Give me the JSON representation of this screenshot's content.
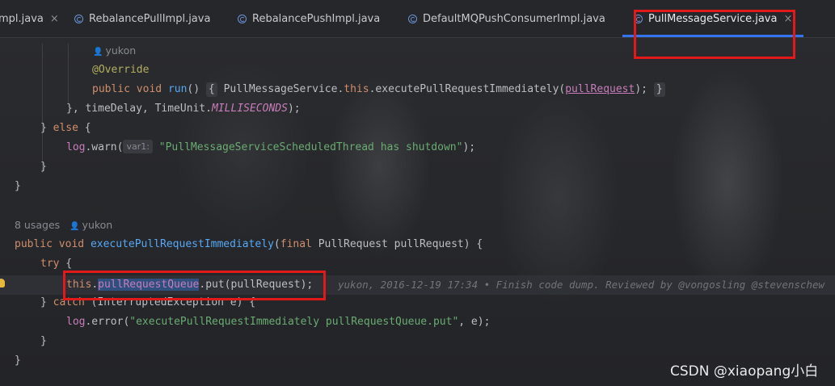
{
  "tabs": [
    {
      "label": "mpl.java",
      "close": "×",
      "icon": "class-icon"
    },
    {
      "label": "RebalancePullImpl.java",
      "icon": "class-icon"
    },
    {
      "label": "RebalancePushImpl.java",
      "icon": "class-icon"
    },
    {
      "label": "DefaultMQPushConsumerImpl.java",
      "icon": "class-icon"
    },
    {
      "label": "PullMessageService.java",
      "close": "×",
      "icon": "class-icon",
      "active": true
    }
  ],
  "code": {
    "author1": "yukon",
    "override": "@Override",
    "run_kw1": "public",
    "run_kw2": "void",
    "run_fn": "run",
    "run_parens": "()",
    "fold_open": "{",
    "run_body_1": "PullMessageService.",
    "run_body_this": "this",
    "run_body_2": ".executePullRequestImmediately(",
    "run_body_arg": "pullRequest",
    "run_body_3": ");",
    "fold_close": "}",
    "line_delay_1": "}, timeDelay, TimeUnit.",
    "line_delay_const": "MILLISECONDS",
    "line_delay_2": ");",
    "else_1": "} ",
    "else_kw": "else",
    "else_2": " {",
    "log_warn_1": "log",
    "log_warn_2": ".warn(",
    "log_warn_hint": "var1:",
    "log_warn_str": "\"PullMessageServiceScheduledThread has shutdown\"",
    "log_warn_3": ");",
    "close_brace": "}",
    "usages": "8 usages",
    "author2": "yukon",
    "method_kw1": "public",
    "method_kw2": "void",
    "method_fn": "executePullRequestImmediately",
    "method_paren": "(",
    "method_final": "final",
    "method_params": " PullRequest pullRequest) {",
    "try_kw": "try",
    "try_brace": " {",
    "put_this": "this",
    "put_dot": ".",
    "put_field": "pullRequestQueue",
    "put_rest": ".put(pullRequest);",
    "blame": "yukon, 2016-12-19 17:34 • Finish code dump. Reviewed by @vongosling @stevenschew",
    "catch_1": "} ",
    "catch_kw": "catch",
    "catch_2": " (InterruptedException e) {",
    "log_err_1": "log",
    "log_err_2": ".error(",
    "log_err_str": "\"executePullRequestImmediately pullRequestQueue.put\"",
    "log_err_3": ", e);"
  },
  "watermark": "CSDN @xiaopang小白",
  "colors": {
    "accent": "#3574f0",
    "highlight_box": "#e2191b",
    "keyword": "#cf8e6d",
    "function": "#56a8f5",
    "string": "#6aab73",
    "field": "#c77dbb"
  }
}
